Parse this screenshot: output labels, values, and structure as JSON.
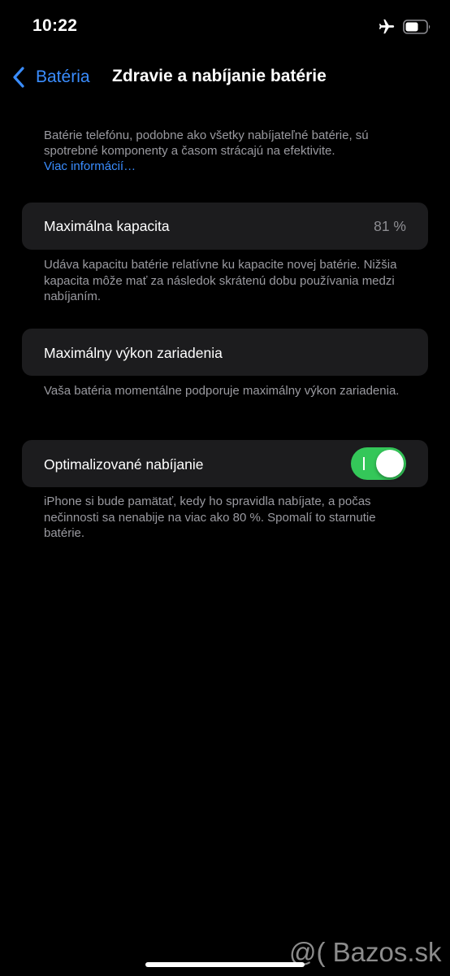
{
  "status_bar": {
    "time": "10:22",
    "icons": [
      "airplane-icon",
      "battery-icon"
    ]
  },
  "nav": {
    "back_label": "Batéria",
    "title": "Zdravie a nabíjanie batérie"
  },
  "intro": {
    "text": "Batérie telefónu, podobne ako všetky nabíjateľné batérie, sú spotrebné komponenty a časom strácajú na efektivite.",
    "link": "Viac informácií…"
  },
  "max_capacity": {
    "label": "Maximálna kapacita",
    "value": "81 %",
    "footnote": "Udáva kapacitu batérie relatívne ku kapacite novej batérie. Nižšia kapacita môže mať za následok skrátenú dobu používania medzi nabíjaním."
  },
  "peak_performance": {
    "label": "Maximálny výkon zariadenia",
    "footnote": "Vaša batéria momentálne podporuje maximálny výkon zariadenia."
  },
  "optimized_charging": {
    "label": "Optimalizované nabíjanie",
    "enabled": true,
    "footnote": "iPhone si bude pamätať, kedy ho spravidla nabíjate, a počas nečinnosti sa nenabije na viac ako 80 %. Spomalí to starnutie batérie."
  },
  "watermark": "@( Bazos.sk",
  "colors": {
    "accent": "#3a8dff",
    "toggle_on": "#34c759",
    "card_bg": "#1c1c1e",
    "secondary_text": "#9a9aa0"
  }
}
